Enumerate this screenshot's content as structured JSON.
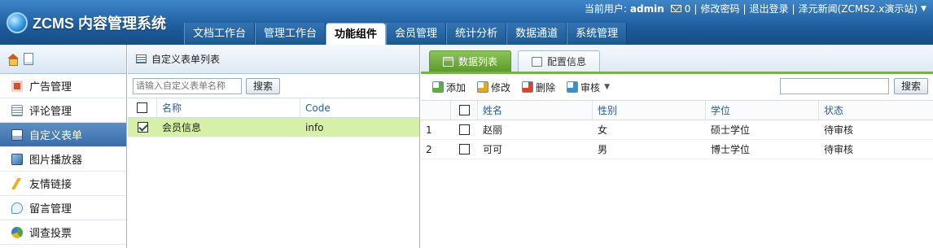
{
  "app": {
    "logo_text": "ZCMS 内容管理系统"
  },
  "top": {
    "user_label": "当前用户:",
    "user_name": "admin",
    "mail_count": "0",
    "sep": "|",
    "change_password": "修改密码",
    "logout": "退出登录",
    "site": "泽元新闻(ZCMS2.x演示站)",
    "dropdown": "▼"
  },
  "nav": [
    "文档工作台",
    "管理工作台",
    "功能组件",
    "会员管理",
    "统计分析",
    "数据通道",
    "系统管理"
  ],
  "sidebar": {
    "items": [
      {
        "label": "广告管理",
        "icon": "ad-icon",
        "color": "#c8553a"
      },
      {
        "label": "评论管理",
        "icon": "comment-list-icon",
        "color": "#7a8fa6"
      },
      {
        "label": "自定义表单",
        "icon": "form-icon",
        "color": "#5a7fa8"
      },
      {
        "label": "图片播放器",
        "icon": "image-player-icon",
        "color": "#3b6ea5"
      },
      {
        "label": "友情链接",
        "icon": "link-bolt-icon",
        "color": "#e6b21e"
      },
      {
        "label": "留言管理",
        "icon": "message-icon",
        "color": "#5b93c9"
      },
      {
        "label": "调查投票",
        "icon": "vote-chart-icon",
        "color": "#4ca14b"
      }
    ]
  },
  "formlist": {
    "title": "自定义表单列表",
    "search_placeholder": "请输入自定义表单名称",
    "search_button": "搜索",
    "columns": [
      "名称",
      "Code"
    ],
    "rows": [
      {
        "name": "会员信息",
        "code": "info",
        "checked": true
      }
    ]
  },
  "tabs": [
    {
      "label": "数据列表"
    },
    {
      "label": "配置信息"
    }
  ],
  "toolbar": {
    "add": "添加",
    "edit": "修改",
    "delete": "删除",
    "audit": "审核",
    "search_button": "搜索"
  },
  "datagrid": {
    "columns": [
      "姓名",
      "性别",
      "学位",
      "状态"
    ],
    "rows": [
      {
        "no": "1",
        "name": "赵丽",
        "gender": "女",
        "degree": "硕士学位",
        "status": "待审核"
      },
      {
        "no": "2",
        "name": "可可",
        "gender": "男",
        "degree": "博士学位",
        "status": "待审核"
      }
    ]
  },
  "colors": {
    "header": "#1e5c9c",
    "accent_green": "#78b14a",
    "selected_row": "#d7f0a8"
  }
}
